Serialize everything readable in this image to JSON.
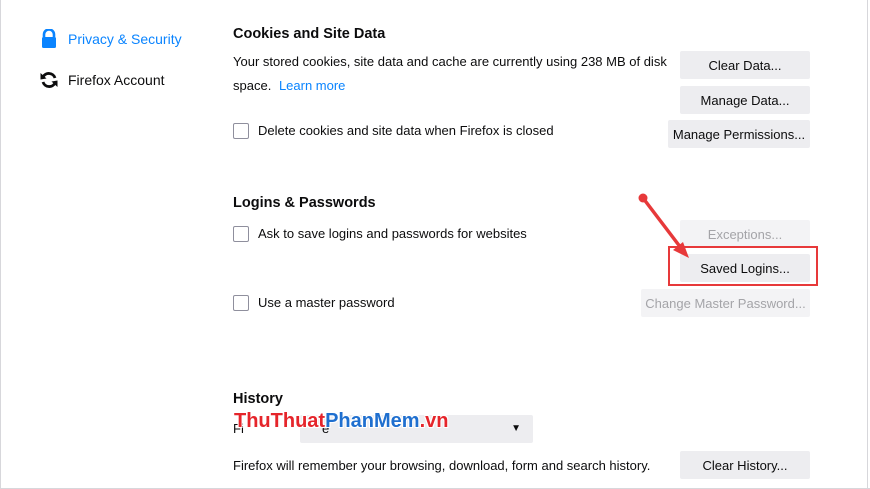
{
  "sidebar": {
    "items": [
      {
        "label": "Privacy & Security",
        "icon": "lock-icon",
        "selected": true
      },
      {
        "label": "Firefox Account",
        "icon": "sync-icon",
        "selected": false
      }
    ]
  },
  "cookies": {
    "title": "Cookies and Site Data",
    "desc_line1": "Your stored cookies, site data and cache are currently using 238 MB of disk",
    "desc_line2": "space.",
    "learn_more": "Learn more",
    "delete_on_close_label": "Delete cookies and site data when Firefox is closed",
    "clear_data_button": "Clear Data...",
    "manage_data_button": "Manage Data...",
    "manage_permissions_button": "Manage Permissions..."
  },
  "logins": {
    "title": "Logins & Passwords",
    "ask_to_save_label": "Ask to save logins and passwords for websites",
    "exceptions_button": "Exceptions...",
    "saved_logins_button": "Saved Logins...",
    "master_password_label": "Use a master password",
    "change_master_password_button": "Change Master Password..."
  },
  "history": {
    "title": "History",
    "select_value_partial_left": "Fi",
    "select_value_partial_right": "e",
    "desc": "Firefox will remember your browsing, download, form and search history.",
    "clear_history_button": "Clear History..."
  },
  "annotation": {
    "color": "#e7393a"
  },
  "watermark": {
    "part1": "ThuThuat",
    "part2": "PhanMem",
    "part3": ".vn"
  }
}
